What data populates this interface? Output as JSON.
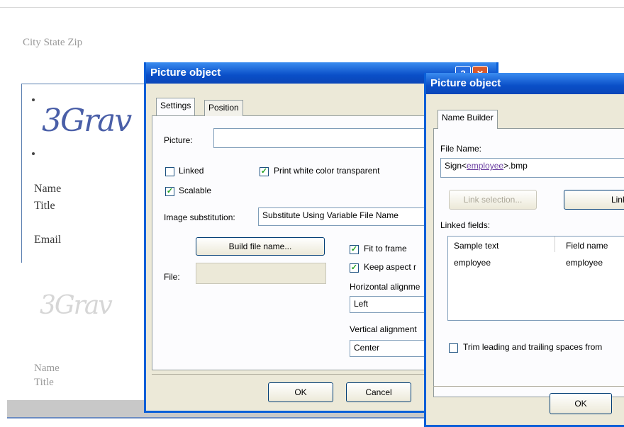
{
  "document": {
    "city_state_zip": "City State Zip",
    "card1": {
      "signature": "3Grav",
      "name": "Name",
      "title": "Title",
      "email": "Email"
    },
    "card2": {
      "name": "Name",
      "title": "Title"
    }
  },
  "dialog1": {
    "title": "Picture object",
    "help_icon": "?",
    "close_icon": "✕",
    "tabs": [
      "Settings",
      "Position"
    ],
    "picture_label": "Picture:",
    "picture_value": "",
    "linked_label": "Linked",
    "linked_checked": false,
    "print_white_label": "Print white color transparent",
    "print_white_checked": true,
    "scalable_label": "Scalable",
    "scalable_checked": true,
    "image_sub_label": "Image substitution:",
    "image_sub_value": "Substitute Using Variable File Name",
    "build_button": "Build file name...",
    "file_label": "File:",
    "file_value": "",
    "fit_label": "Fit to frame",
    "fit_checked": true,
    "keep_label": "Keep aspect r",
    "keep_checked": true,
    "halign_label": "Horizontal alignme",
    "halign_value": "Left",
    "valign_label": "Vertical alignment",
    "valign_value": "Center",
    "ok": "OK",
    "cancel": "Cancel"
  },
  "dialog2": {
    "title": "Picture object",
    "tab": "Name Builder",
    "file_name_label": "File Name:",
    "file_name_prefix": "Sign<",
    "file_name_field": "employee",
    "file_name_suffix": ">.bmp",
    "link_selection": "Link selection...",
    "link_all": "Link a",
    "linked_fields_label": "Linked fields:",
    "columns": [
      "Sample text",
      "Field name"
    ],
    "rows": [
      {
        "sample": "employee",
        "field": "employee"
      }
    ],
    "trim_label": "Trim leading and trailing spaces from",
    "trim_checked": false,
    "ok": "OK"
  },
  "colors": {
    "title_blue": "#0a4fc8",
    "dialog_bg": "#ece9d8",
    "check_green": "#21a121"
  }
}
